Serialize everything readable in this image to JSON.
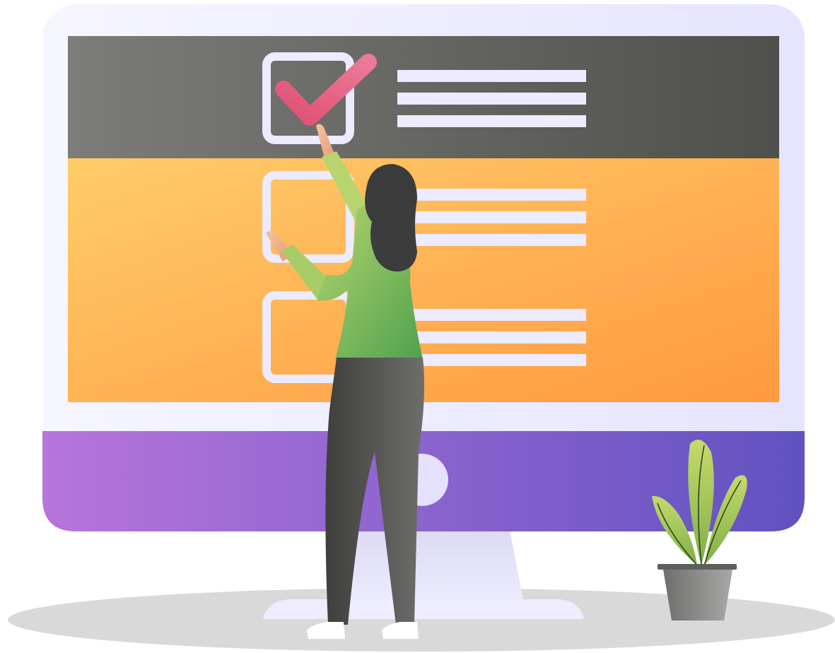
{
  "illustration": {
    "subject": "person-checking-checklist-on-monitor",
    "items": [
      {
        "state": "checked",
        "line_count": 3
      },
      {
        "state": "unchecked",
        "line_count": 3
      },
      {
        "state": "unchecked",
        "line_count": 3
      }
    ],
    "colors": {
      "header_bar_left": "#7a7a78",
      "header_bar_right": "#4f4f4b",
      "screen_orange_left": "#ffc766",
      "screen_orange_right": "#ff9a40",
      "chin_purple_left": "#b474da",
      "chin_purple_right": "#6455c2",
      "bezel": "#eceaff",
      "checkmark": "#e85a7b",
      "shirt": "#74b85a",
      "pants": "#555555",
      "hair": "#3f3f3f",
      "plant_leaf": "#a8cc55",
      "pot": "#8a8a8a",
      "floor_shadow": "#d8d8d8"
    }
  }
}
